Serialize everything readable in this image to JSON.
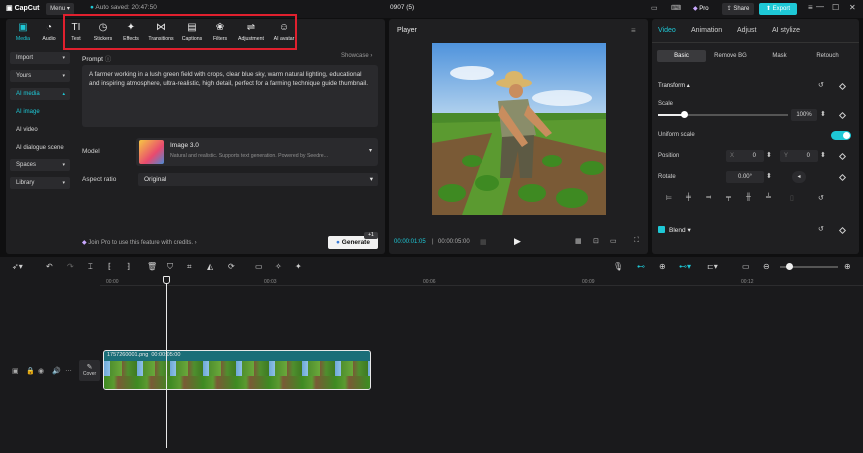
{
  "titlebar": {
    "logo": "CapCut",
    "menu_label": "Menu",
    "autosave": "Auto saved: 20:47:50",
    "project_name": "0907 (5)",
    "pro_label": "Pro",
    "share_label": "Share",
    "export_label": "Export"
  },
  "toolbar": {
    "media": "Media",
    "audio": "Audio",
    "items": [
      "Text",
      "Stickers",
      "Effects",
      "Transitions",
      "Captions",
      "Filters",
      "Adjustment",
      "AI avatar"
    ]
  },
  "left_nav": {
    "import": "Import",
    "yours": "Yours",
    "ai_media": "AI media",
    "ai_image": "AI image",
    "ai_video": "AI video",
    "ai_dialogue": "AI dialogue scene",
    "spaces": "Spaces",
    "library": "Library"
  },
  "prompt": {
    "label": "Prompt",
    "showcase": "Showcase",
    "text": "A farmer working in a lush green field with crops, clear blue sky, warm natural lighting, educational and inspiring atmosphere, ultra-realistic, high detail, perfect for a farming technique guide thumbnail."
  },
  "model": {
    "label": "Model",
    "name": "Image 3.0",
    "desc": "Natural and realistic. Supports text generation. Powered by Seedre..."
  },
  "aspect": {
    "label": "Aspect ratio",
    "value": "Original"
  },
  "join_pro": "Join Pro to use this feature with credits.",
  "generate": {
    "label": "Generate",
    "badge": "+1"
  },
  "player": {
    "title": "Player",
    "current": "00:00:01:05",
    "total": "00:00:05:00"
  },
  "right_panel": {
    "tabs": [
      "Video",
      "Animation",
      "Adjust",
      "AI stylize"
    ],
    "subtabs": [
      "Basic",
      "Remove BG",
      "Mask",
      "Retouch"
    ],
    "transform": "Transform",
    "scale": "Scale",
    "scale_value": "100%",
    "uniform_scale": "Uniform scale",
    "position": "Position",
    "x_label": "X",
    "x_value": "0",
    "y_label": "Y",
    "y_value": "0",
    "rotate": "Rotate",
    "rotate_value": "0.00°",
    "blend": "Blend"
  },
  "timeline": {
    "ruler": [
      "00:00",
      "00:03",
      "00:06",
      "00:09",
      "00:12"
    ],
    "cover_label": "Cover",
    "clip_name": "1757260001.png",
    "clip_duration": "00:00:05:00"
  },
  "colors": {
    "accent": "#1ec8d6",
    "highlight_box": "#e0202e",
    "panel": "#1f1f21",
    "background": "#0f0f10"
  }
}
